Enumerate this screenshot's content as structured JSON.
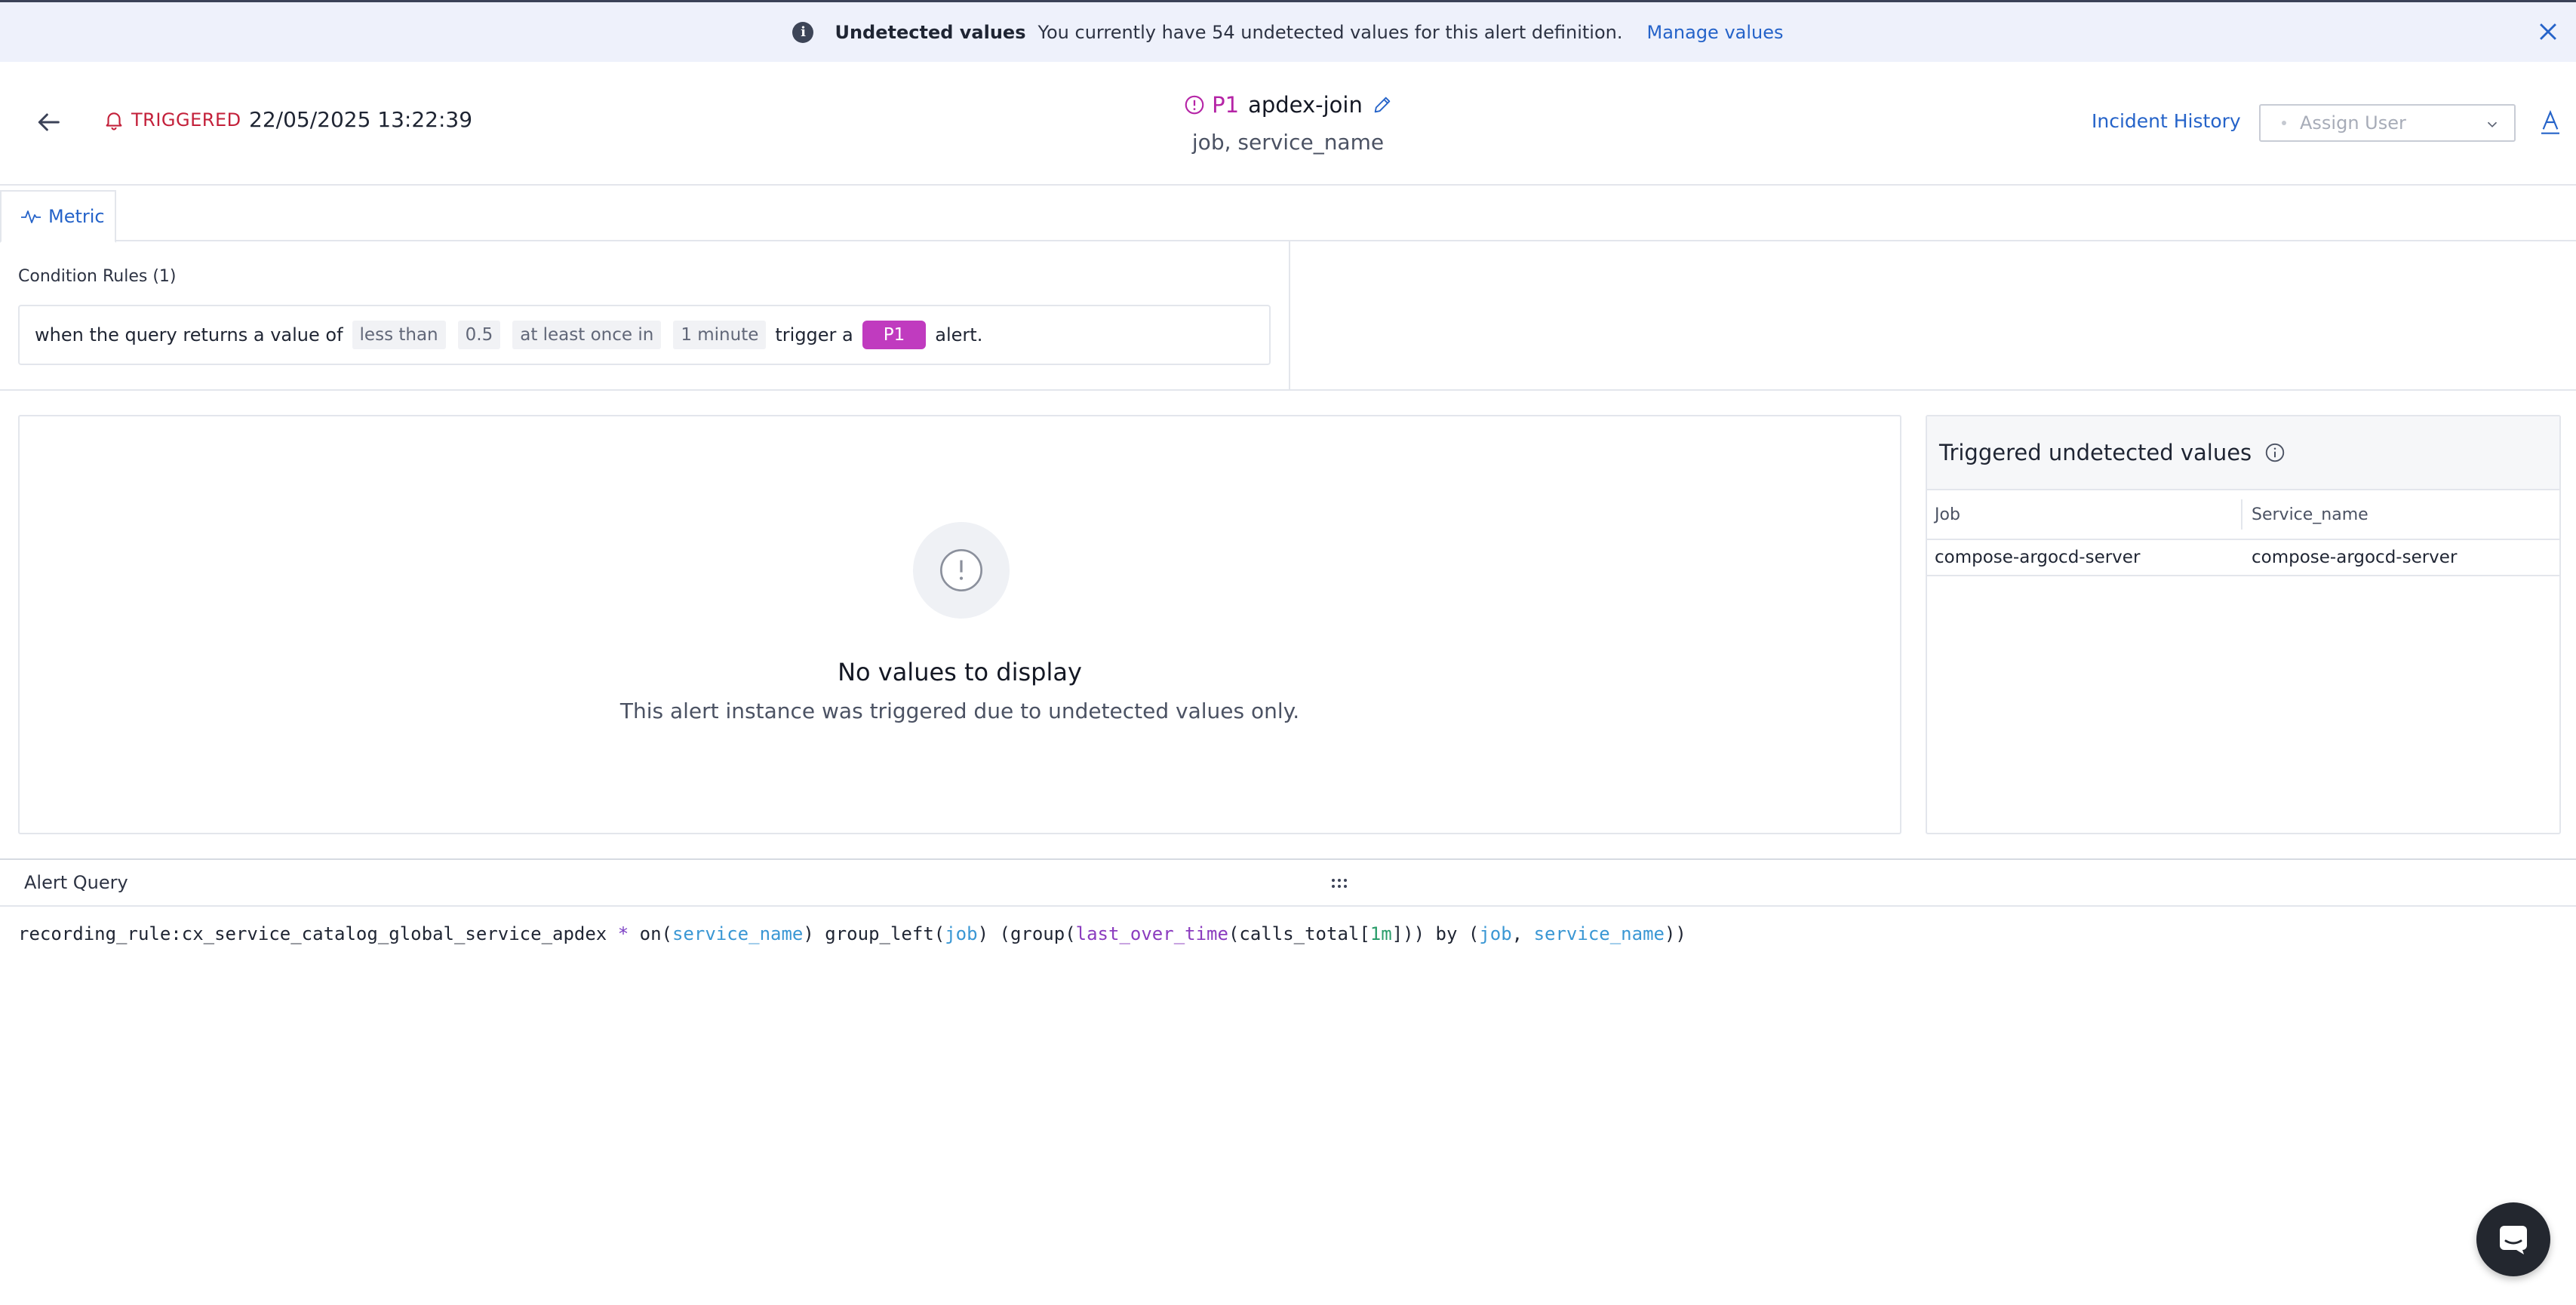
{
  "banner": {
    "title": "Undetected values",
    "message": "You currently have 54 undetected values for this alert definition.",
    "link": "Manage values"
  },
  "header": {
    "status": "TRIGGERED",
    "timestamp": "22/05/2025 13:22:39",
    "priority": "P1",
    "alert_name": "apdex-join",
    "group_by": "job, service_name",
    "incident_history": "Incident History",
    "assign_placeholder": "Assign User"
  },
  "tabs": [
    {
      "label": "Metric"
    }
  ],
  "conditions": {
    "heading": "Condition Rules (1)",
    "rule": {
      "prefix": "when the query returns a value of",
      "operator": "less than",
      "threshold": "0.5",
      "frequency": "at least once in",
      "window": "1 minute",
      "trigger_text": "trigger a",
      "priority": "P1",
      "suffix": "alert."
    }
  },
  "empty_state": {
    "title": "No values to display",
    "description": "This alert instance was triggered due to undetected values only."
  },
  "undetected": {
    "title": "Triggered undetected values",
    "columns": [
      "Job",
      "Service_name"
    ],
    "rows": [
      [
        "compose-argocd-server",
        "compose-argocd-server"
      ]
    ]
  },
  "query": {
    "title": "Alert Query",
    "tokens": {
      "t1": "recording_rule:cx_service_catalog_global_service_apdex ",
      "t2": "*",
      "t3": " ",
      "t4": "on",
      "t5": "(",
      "t6": "service_name",
      "t7": ") ",
      "t8": "group_left",
      "t9": "(",
      "t10": "job",
      "t11": ") (",
      "t12": "group",
      "t13": "(",
      "t14": "last_over_time",
      "t15": "(calls_total[",
      "t16": "1m",
      "t17": "])) ",
      "t18": "by",
      "t19": " (",
      "t20": "job",
      "t21": ", ",
      "t22": "service_name",
      "t23": "))"
    }
  },
  "colors": {
    "accent": "#2563c9",
    "triggered": "#c3203a",
    "priority_p1": "#c03bbf"
  }
}
